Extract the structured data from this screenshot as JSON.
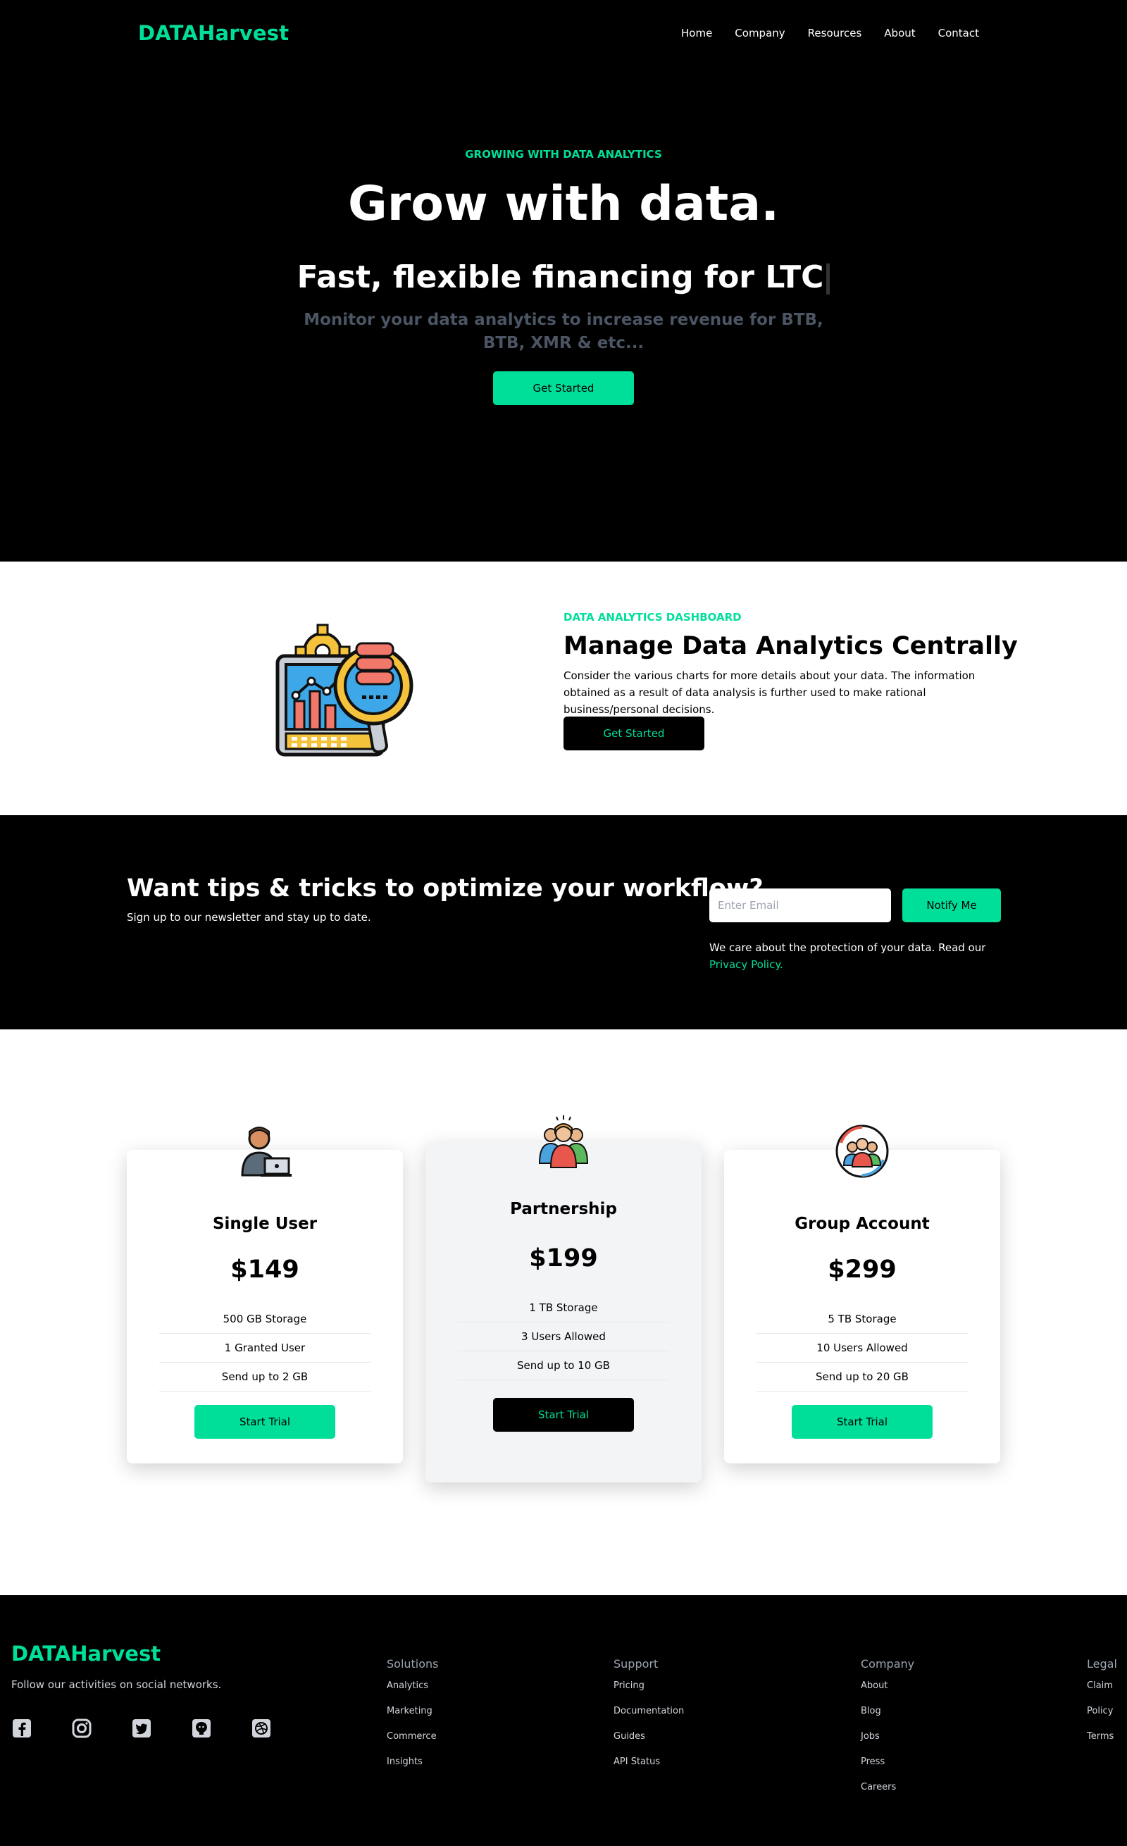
{
  "nav": {
    "logo": "DATAHarvest",
    "links": [
      "Home",
      "Company",
      "Resources",
      "About",
      "Contact"
    ]
  },
  "hero": {
    "eyebrow": "GROWING WITH DATA ANALYTICS",
    "title": "Grow with data.",
    "subtitle": "Fast, flexible financing for LTC",
    "description": "Monitor your data analytics to increase revenue for BTB, BTB, XMR & etc...",
    "button": "Get Started"
  },
  "analytics": {
    "eyebrow": "DATA ANALYTICS DASHBOARD",
    "title": "Manage Data Analytics Centrally",
    "text": "Consider the various charts for more details about your data. The information obtained as a result of data analysis is further used to make rational business/personal decisions.",
    "button": "Get Started",
    "icon": "analytics-dashboard-icon"
  },
  "newsletter": {
    "title": "Want tips & tricks to optimize your workflow?",
    "text": "Sign up to our newsletter and stay up to date.",
    "email_placeholder": "Enter Email",
    "button": "Notify Me",
    "privacy_text": "We care about the protection of your data. Read our",
    "privacy_link": "Privacy Policy."
  },
  "pricing": {
    "plans": [
      {
        "title": "Single User",
        "price": "$149",
        "features": [
          "500 GB Storage",
          "1 Granted User",
          "Send up to 2 GB"
        ],
        "button": "Start Trial",
        "icon": "single-user-icon"
      },
      {
        "title": "Partnership",
        "price": "$199",
        "features": [
          "1 TB Storage",
          "3 Users Allowed",
          "Send up to 10 GB"
        ],
        "button": "Start Trial",
        "icon": "partnership-icon"
      },
      {
        "title": "Group Account",
        "price": "$299",
        "features": [
          "5 TB Storage",
          "10 Users Allowed",
          "Send up to 20 GB"
        ],
        "button": "Start Trial",
        "icon": "group-account-icon"
      }
    ]
  },
  "footer": {
    "logo": "DATAHarvest",
    "tagline": "Follow our activities on social networks.",
    "social_icons": [
      "facebook-icon",
      "instagram-icon",
      "twitter-icon",
      "github-icon",
      "dribbble-icon"
    ],
    "columns": [
      {
        "title": "Solutions",
        "links": [
          "Analytics",
          "Marketing",
          "Commerce",
          "Insights"
        ]
      },
      {
        "title": "Support",
        "links": [
          "Pricing",
          "Documentation",
          "Guides",
          "API Status"
        ]
      },
      {
        "title": "Company",
        "links": [
          "About",
          "Blog",
          "Jobs",
          "Press",
          "Careers"
        ]
      },
      {
        "title": "Legal",
        "links": [
          "Claim",
          "Policy",
          "Terms"
        ]
      }
    ]
  },
  "colors": {
    "accent": "#00df9a",
    "background": "#000000",
    "muted": "#4b5563"
  }
}
